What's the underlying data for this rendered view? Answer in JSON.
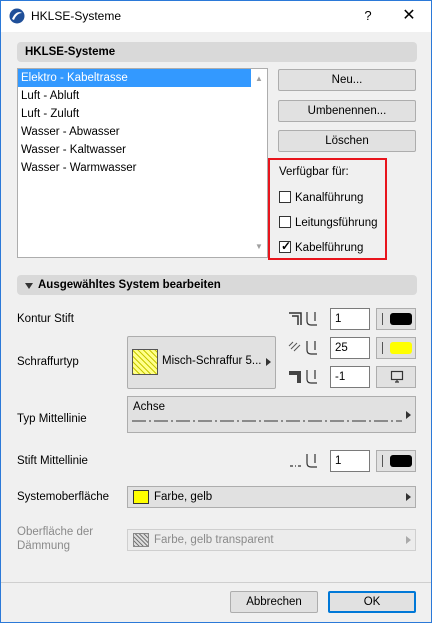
{
  "window": {
    "title": "HKLSE-Systeme",
    "help_label": "?",
    "close_label": "✕"
  },
  "systems": {
    "header": "HKLSE-Systeme",
    "items": [
      {
        "label": "Elektro - Kabeltrasse"
      },
      {
        "label": "Luft - Abluft"
      },
      {
        "label": "Luft - Zuluft"
      },
      {
        "label": "Wasser - Abwasser"
      },
      {
        "label": "Wasser - Kaltwasser"
      },
      {
        "label": "Wasser - Warmwasser"
      }
    ],
    "selected_index": 0
  },
  "buttons": {
    "new": "Neu...",
    "rename": "Umbenennen...",
    "delete": "Löschen"
  },
  "availability": {
    "title": "Verfügbar für:",
    "options": [
      {
        "label": "Kanalführung",
        "checked": false
      },
      {
        "label": "Leitungsführung",
        "checked": false
      },
      {
        "label": "Kabelführung",
        "checked": true
      }
    ],
    "check_glyph": "✓"
  },
  "edit": {
    "header": "Ausgewähltes System bearbeiten",
    "contour_pen": {
      "label": "Kontur Stift",
      "value": "1",
      "color": "#000000"
    },
    "hatch": {
      "label": "Schraffurtyp",
      "name": "Misch-Schraffur 5...",
      "fg_pen": "25",
      "fg_color": "#ffff00",
      "bg_pen": "-1",
      "swatch_color": "#ffff00"
    },
    "centerline": {
      "label": "Typ Mittellinie",
      "name": "Achse"
    },
    "centerline_pen": {
      "label": "Stift Mittellinie",
      "value": "1",
      "color": "#000000"
    },
    "surface": {
      "label": "Systemoberfläche",
      "name": "Farbe, gelb",
      "color": "#ffff00"
    },
    "insulation_surface": {
      "label_line1": "Oberfläche der",
      "label_line2": "Dämmung",
      "name": "Farbe, gelb transparent",
      "disabled": true
    }
  },
  "footer": {
    "cancel": "Abbrechen",
    "ok": "OK"
  }
}
